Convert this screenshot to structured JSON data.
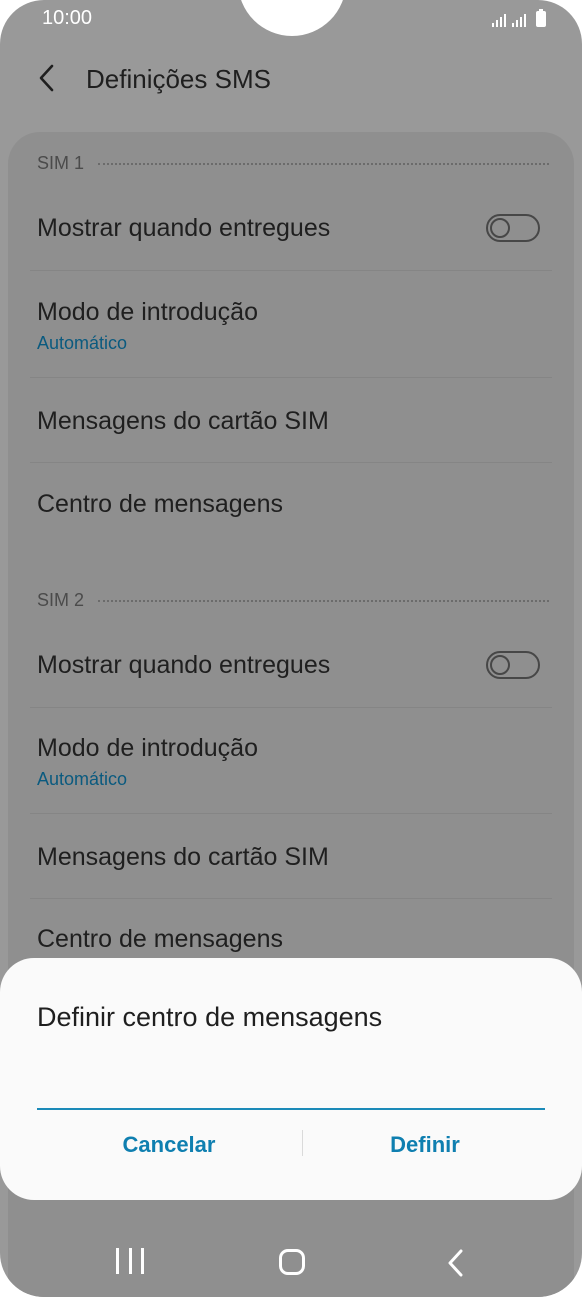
{
  "status_bar": {
    "time": "10:00"
  },
  "app_bar": {
    "title": "Definições SMS"
  },
  "sim1": {
    "header": "SIM 1",
    "show_delivered": {
      "label": "Mostrar quando entregues",
      "enabled": false
    },
    "input_mode": {
      "label": "Modo de introdução",
      "value": "Automático"
    },
    "sim_messages": {
      "label": "Mensagens do cartão SIM"
    },
    "message_center": {
      "label": "Centro de mensagens"
    }
  },
  "sim2": {
    "header": "SIM 2",
    "show_delivered": {
      "label": "Mostrar quando entregues",
      "enabled": false
    },
    "input_mode": {
      "label": "Modo de introdução",
      "value": "Automático"
    },
    "sim_messages": {
      "label": "Mensagens do cartão SIM"
    },
    "message_center": {
      "label": "Centro de mensagens"
    }
  },
  "dialog": {
    "title": "Definir centro de mensagens",
    "input_value": "",
    "cancel_label": "Cancelar",
    "confirm_label": "Definir"
  },
  "nav_bar": {
    "icons": [
      "recent-apps-icon",
      "home-icon",
      "back-icon"
    ]
  },
  "colors": {
    "accent": "#0f7fb0",
    "scrim": "#999999",
    "dialog_bg": "#fafafa"
  }
}
